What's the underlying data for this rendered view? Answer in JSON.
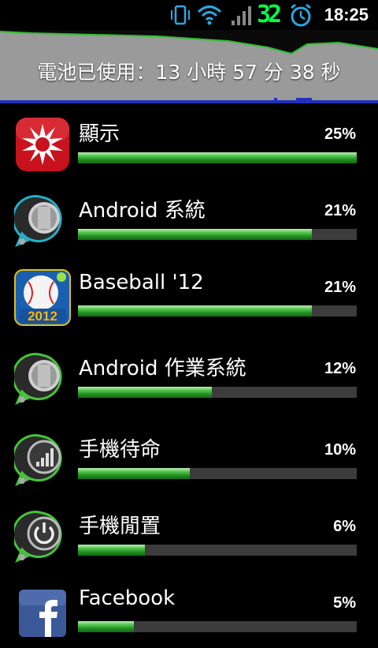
{
  "status_bar": {
    "time": "18:25",
    "battery_level": "32",
    "icons": [
      "vibrate-icon",
      "wifi-icon",
      "signal-icon",
      "battery-level-icon",
      "alarm-icon"
    ]
  },
  "header": {
    "usage_text": "電池已使用：13 小時 57 分 38 秒"
  },
  "items": [
    {
      "name": "顯示",
      "percent": "25%",
      "value": 25,
      "icon": "display-icon"
    },
    {
      "name": "Android 系統",
      "percent": "21%",
      "value": 21,
      "icon": "android-system-icon"
    },
    {
      "name": "Baseball '12",
      "percent": "21%",
      "value": 21,
      "icon": "baseball-app-icon"
    },
    {
      "name": "Android 作業系統",
      "percent": "12%",
      "value": 12,
      "icon": "android-os-icon"
    },
    {
      "name": "手機待命",
      "percent": "10%",
      "value": 10,
      "icon": "cell-standby-icon"
    },
    {
      "name": "手機閒置",
      "percent": "6%",
      "value": 6,
      "icon": "phone-idle-icon"
    },
    {
      "name": "Facebook",
      "percent": "5%",
      "value": 5,
      "icon": "facebook-icon"
    }
  ],
  "max_value": 25,
  "colors": {
    "bar_green": "#2e9c2a",
    "bar_track": "#3c3c3c",
    "battery_digits": "#00ff44",
    "status_icons": "#2aa7e0",
    "graph_line": "#1f2fb8"
  }
}
